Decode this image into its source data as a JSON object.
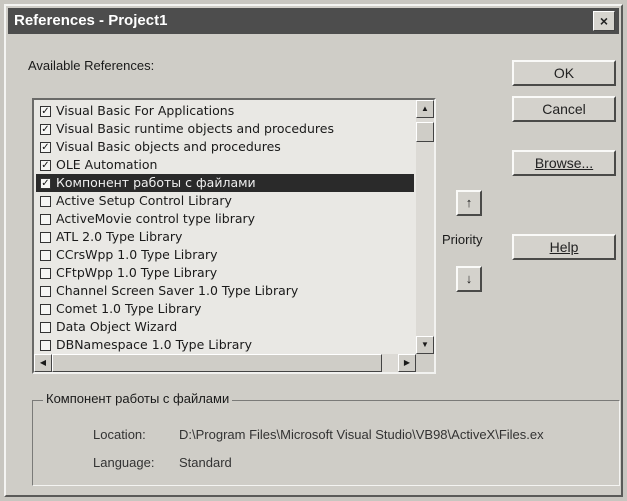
{
  "window": {
    "title": "References - Project1",
    "close_glyph": "×"
  },
  "available_label": "Available References:",
  "references": [
    {
      "label": "Visual Basic For Applications",
      "checked": true
    },
    {
      "label": "Visual Basic runtime objects and procedures",
      "checked": true
    },
    {
      "label": "Visual Basic objects and procedures",
      "checked": true
    },
    {
      "label": "OLE Automation",
      "checked": true
    },
    {
      "label": "Компонент работы с файлами",
      "checked": true,
      "selected": true
    },
    {
      "label": "Active Setup Control Library",
      "checked": false
    },
    {
      "label": "ActiveMovie control type library",
      "checked": false
    },
    {
      "label": "ATL 2.0 Type Library",
      "checked": false
    },
    {
      "label": "CCrsWpp 1.0 Type Library",
      "checked": false
    },
    {
      "label": "CFtpWpp 1.0 Type Library",
      "checked": false
    },
    {
      "label": "Channel Screen Saver 1.0 Type Library",
      "checked": false
    },
    {
      "label": "Comet 1.0 Type Library",
      "checked": false
    },
    {
      "label": "Data Object Wizard",
      "checked": false
    },
    {
      "label": "DBNamespace 1.0 Type Library",
      "checked": false
    }
  ],
  "buttons": {
    "ok": "OK",
    "cancel": "Cancel",
    "browse": "Browse...",
    "help": "Help"
  },
  "priority": {
    "label": "Priority",
    "up_glyph": "↑",
    "down_glyph": "↓"
  },
  "details": {
    "group_title": "Компонент работы с файлами",
    "location_label": "Location:",
    "location_value": "D:\\Program Files\\Microsoft Visual Studio\\VB98\\ActiveX\\Files.ex",
    "language_label": "Language:",
    "language_value": "Standard"
  },
  "icons": {
    "scroll_up": "scroll-up-arrow",
    "scroll_down": "scroll-down-arrow",
    "scroll_left": "scroll-left-arrow",
    "scroll_right": "scroll-right-arrow"
  }
}
